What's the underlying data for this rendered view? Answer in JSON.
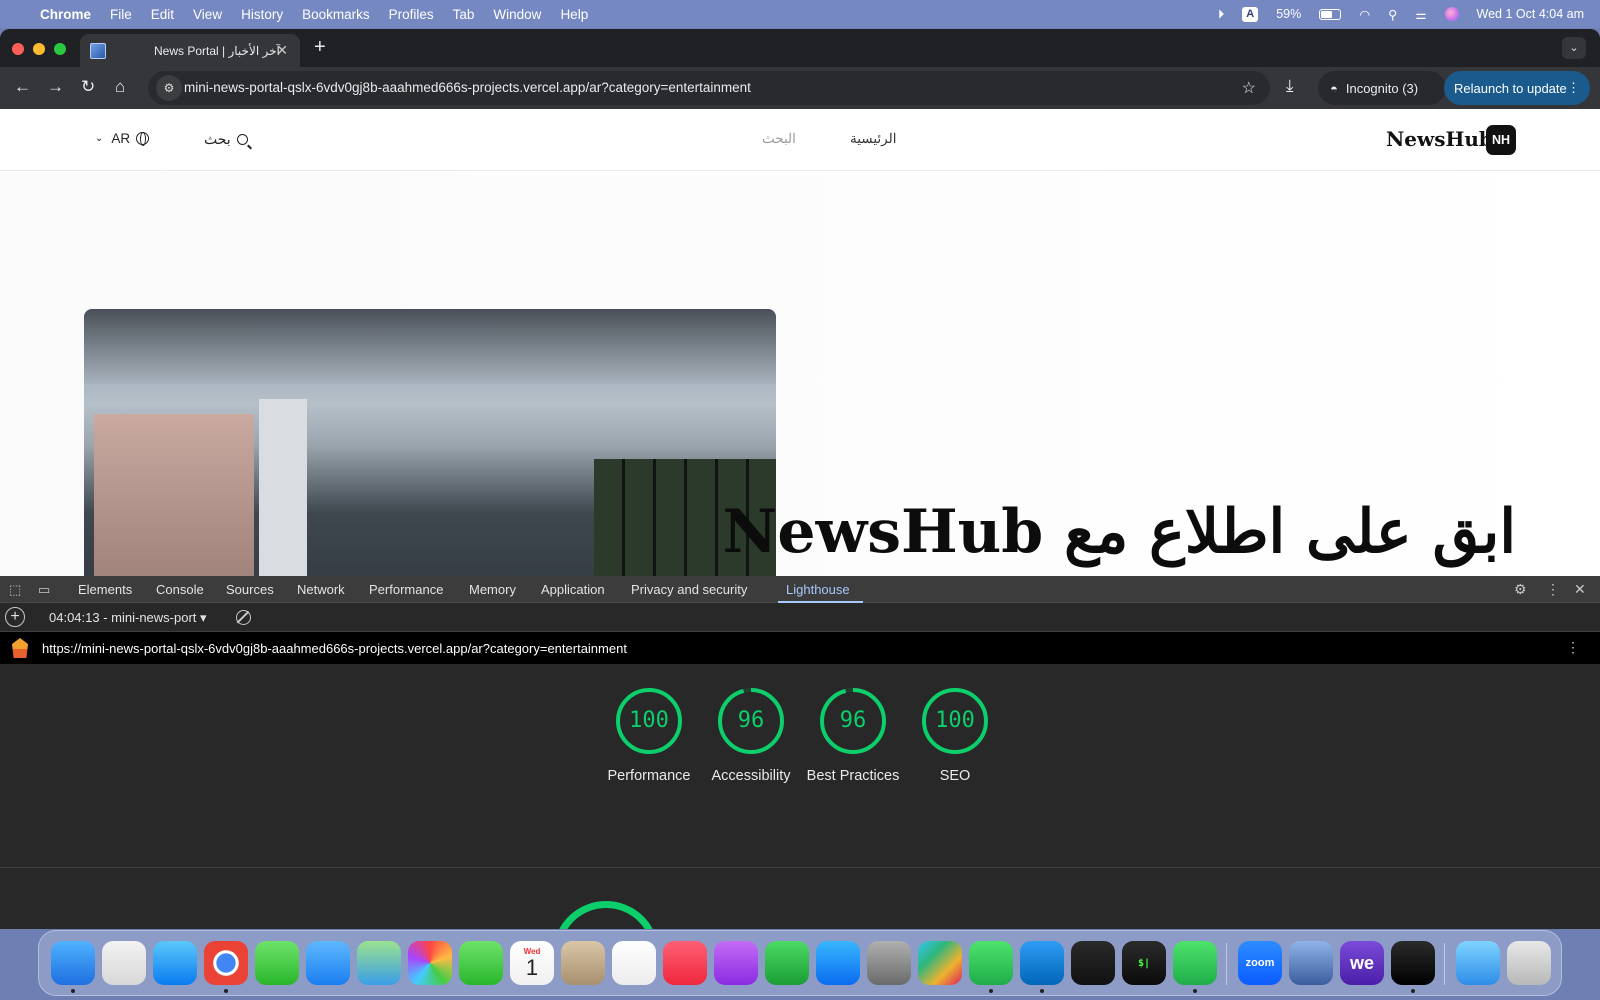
{
  "menubar": {
    "apple": "",
    "app": "Chrome",
    "items": [
      "File",
      "Edit",
      "View",
      "History",
      "Bookmarks",
      "Profiles",
      "Tab",
      "Window",
      "Help"
    ],
    "input_source": "A",
    "battery": "59%",
    "datetime": "Wed 1 Oct  4:04 am"
  },
  "browser": {
    "tab_title": "News Portal | آخر الأخبار",
    "url": "mini-news-portal-qslx-6vdv0gj8b-aaahmed666s-projects.vercel.app/ar?category=entertainment",
    "incognito": "Incognito (3)",
    "relaunch": "Relaunch to update"
  },
  "site": {
    "lang": "AR",
    "search_button": "بحث",
    "nav_search": "البحث",
    "nav_home": "الرئيسية",
    "brand": "NewsHub",
    "logo": "NH",
    "hero_title": "ابق على اطلاع مع NewsHub"
  },
  "devtools": {
    "tabs": [
      "Elements",
      "Console",
      "Sources",
      "Network",
      "Performance",
      "Memory",
      "Application",
      "Privacy and security",
      "Lighthouse"
    ],
    "active_tab": "Lighthouse",
    "report_select": "04:04:13 - mini-news-port",
    "report_url": "https://mini-news-portal-qslx-6vdv0gj8b-aaahmed666s-projects.vercel.app/ar?category=entertainment",
    "scores": [
      {
        "label": "Performance",
        "value": 100
      },
      {
        "label": "Accessibility",
        "value": 96
      },
      {
        "label": "Best Practices",
        "value": 96
      },
      {
        "label": "SEO",
        "value": 100
      }
    ],
    "score_color": "#0cce6b"
  },
  "dock": {
    "apps": [
      "Finder",
      "Launchpad",
      "Safari",
      "Chrome",
      "Messages",
      "Mail",
      "Maps",
      "Photos",
      "FaceTime",
      "Calendar",
      "Contacts",
      "Reminders",
      "Music",
      "Podcasts",
      "Numbers",
      "App Store",
      "System Settings",
      "Slack",
      "WhatsApp",
      "VS Code",
      "Cursor",
      "Terminal",
      "WhatsApp Business",
      "Zoom",
      "Finder Utility",
      "WE",
      "GitHub Desktop",
      "Downloads",
      "Trash"
    ],
    "calendar_day": "1",
    "calendar_month": "Wed",
    "zoom_label": "zoom",
    "we_label": "we",
    "terminal_label": "$|"
  }
}
